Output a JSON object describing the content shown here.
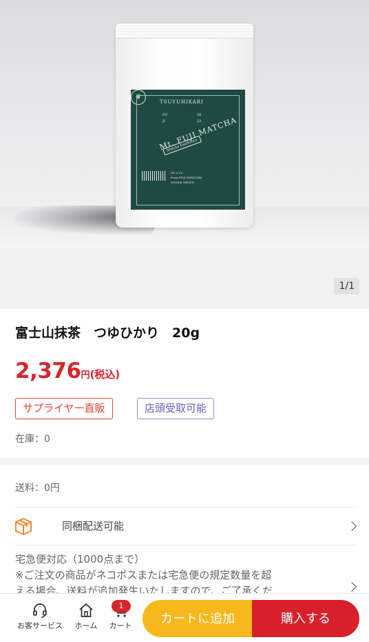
{
  "product_image": {
    "pager": "1/1",
    "label": {
      "brand": "TSUYUHIKARI",
      "emblem_left_top": "FU",
      "emblem_left_bottom": "JI",
      "emblem_right_top": "20",
      "emblem_right_bottom": "23",
      "title": "Mt. FUJI MATCHA",
      "subtitle": "Matcha EmiNence",
      "info_line1": "Mt & Co.",
      "info_line2": "From FUJI SHIZUOKA",
      "info_line3": "SINGLE ORIGIN"
    }
  },
  "product": {
    "title": "富士山抹茶　つゆひかり　20g",
    "price": "2,376",
    "price_unit": "円",
    "price_tax": "(税込)",
    "badges": [
      "サプライヤー直販",
      "店頭受取可能"
    ],
    "stock": "在庫：0"
  },
  "delivery": {
    "shipping": "送料：0円",
    "bundle_label": "同梱配送可能",
    "note_line1": "宅急便対応（1000点まで）",
    "note_line2": "※ご注文の商品がネコポスまたは宅急便の規定数量を超",
    "note_line3": "える場合、送料が追加発生いたしますので、ご了承くだ"
  },
  "bottom_bar": {
    "support_label": "お客サービス",
    "home_label": "ホーム",
    "cart_label": "カート",
    "cart_count": "1",
    "add_to_cart": "カートに追加",
    "buy_now": "購入する"
  },
  "colors": {
    "price_red": "#d8242c",
    "add_button": "#f7b81b",
    "buy_button": "#d8202a",
    "label_green": "#1f4a43"
  }
}
